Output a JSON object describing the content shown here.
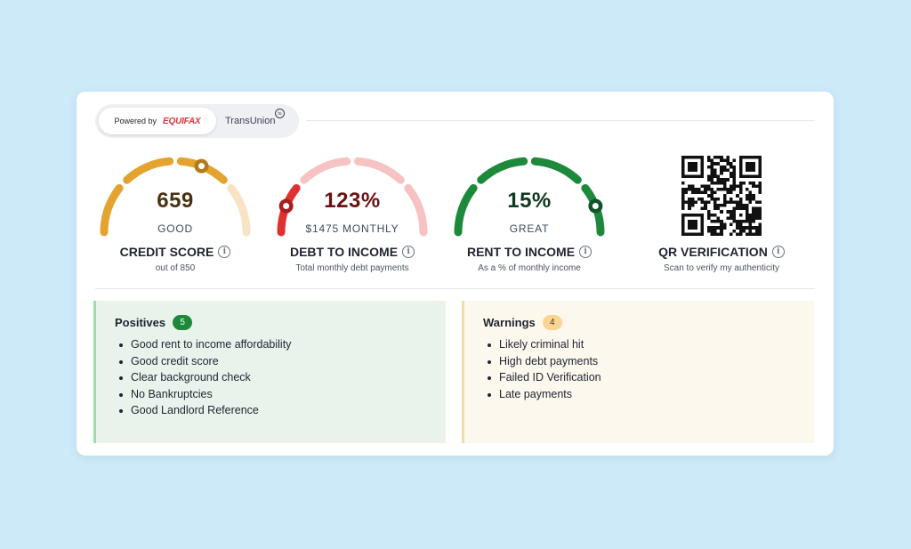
{
  "providers": {
    "powered_by": "Powered by",
    "equifax": "EQUIFAX",
    "transunion": "TransUnion",
    "transunion_badge": "tu",
    "selected": "EQUIFAX"
  },
  "gauges": [
    {
      "id": "credit",
      "value": "659",
      "status": "GOOD",
      "title": "CREDIT SCORE",
      "subtitle": "out of 850",
      "level": 0.62,
      "value_color": "#4a3210",
      "active_color": "#e3a32e",
      "inactive_color": "#f8e3c4",
      "knob_color": "#b27b1a"
    },
    {
      "id": "debt",
      "value": "123%",
      "status": "$1475 MONTHLY",
      "title": "DEBT TO INCOME",
      "subtitle": "Total monthly debt payments",
      "level": 0.12,
      "value_color": "#6b1212",
      "active_color": "#e03131",
      "inactive_color": "#f6c2c2",
      "knob_color": "#a81d1d"
    },
    {
      "id": "rent",
      "value": "15%",
      "status": "GREAT",
      "title": "RENT TO INCOME",
      "subtitle": "As a % of monthly income",
      "level": 0.88,
      "value_color": "#0e3a1f",
      "active_color": "#1c8a3a",
      "inactive_color": "#cfe9d6",
      "knob_color": "#10552a"
    }
  ],
  "qr": {
    "title": "QR VERIFICATION",
    "subtitle": "Scan to verify my authenticity"
  },
  "positives": {
    "title": "Positives",
    "count": "5",
    "items": [
      "Good rent to income affordability",
      "Good credit score",
      "Clear background check",
      "No Bankruptcies",
      "Good Landlord Reference"
    ]
  },
  "warnings": {
    "title": "Warnings",
    "count": "4",
    "items": [
      "Likely criminal hit",
      "High debt payments",
      "Failed ID Verification",
      "Late payments"
    ]
  },
  "icons": {
    "info": "i"
  }
}
